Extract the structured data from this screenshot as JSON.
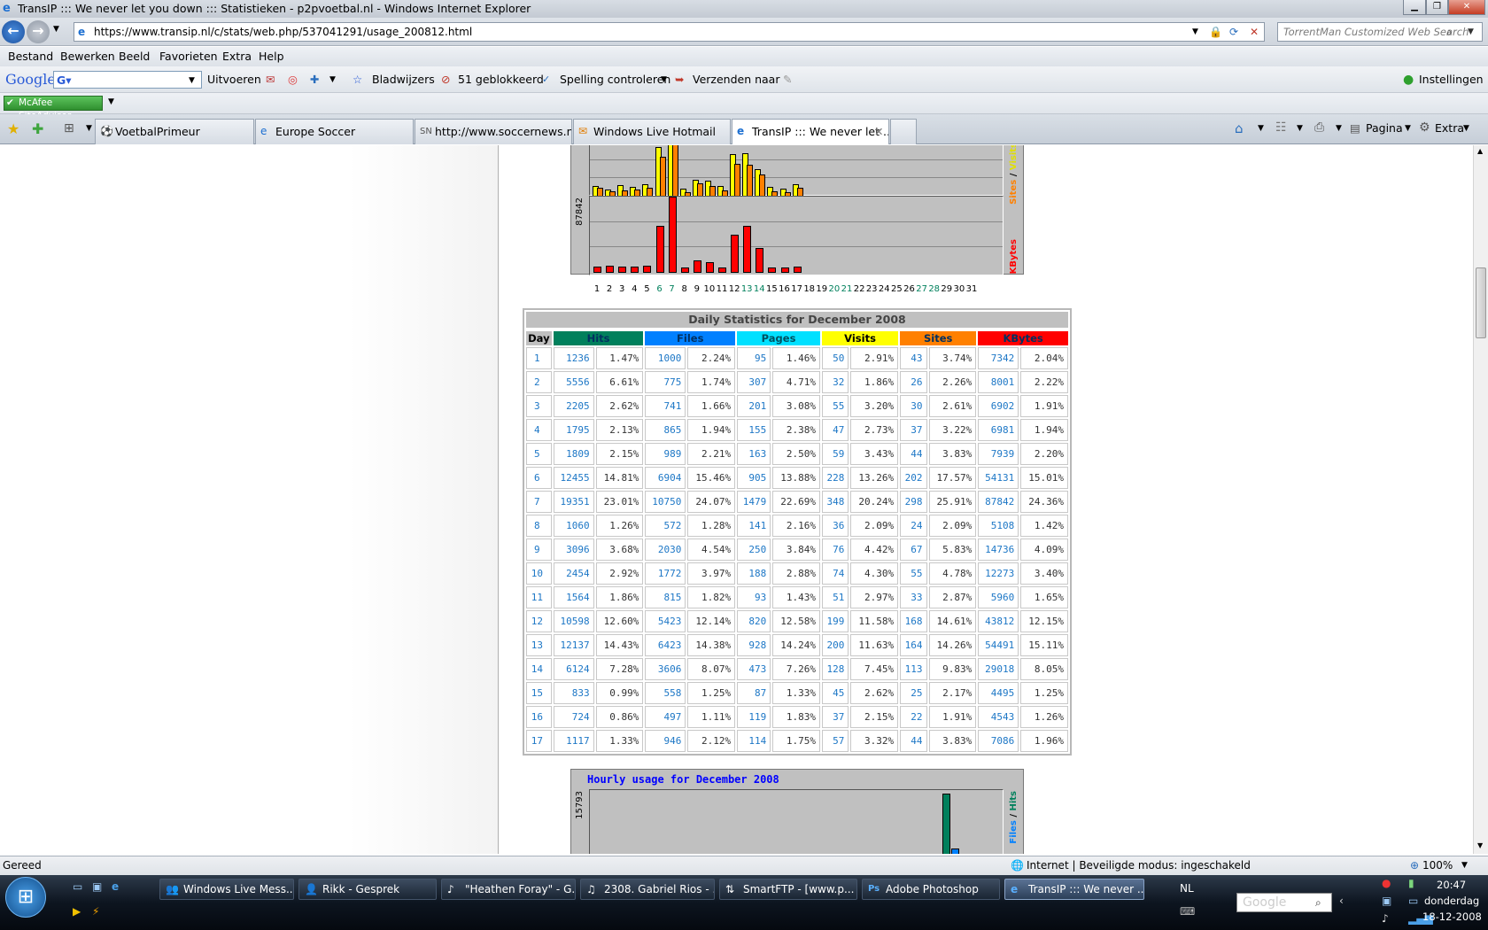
{
  "window": {
    "title": "TransIP ::: We never let you down ::: Statistieken - p2pvoetbal.nl - Windows Internet Explorer"
  },
  "address": {
    "url": "https://www.transip.nl/c/stats/web.php/537041291/usage_200812.html",
    "search_placeholder": "TorrentMan Customized Web Search"
  },
  "menu": [
    "Bestand",
    "Bewerken",
    "Beeld",
    "Favorieten",
    "Extra",
    "Help"
  ],
  "google_toolbar": {
    "logo": "Google",
    "run": "Uitvoeren",
    "bookmarks": "Bladwijzers",
    "blocked": "51 geblokkeerd",
    "spell": "Spelling controleren",
    "send": "Verzenden naar",
    "settings": "Instellingen"
  },
  "mcafee": {
    "label": "McAfee SiteAdvisor"
  },
  "tabs": [
    "VoetbalPrimeur",
    "Europe Soccer",
    "http://www.soccernews.nl...",
    "Windows Live Hotmail",
    "TransIP ::: We never let ..."
  ],
  "tab_favicons": [
    "⚽",
    "e",
    "SN",
    "✉",
    "e"
  ],
  "command_bar": {
    "page": "Pagina",
    "extra": "Extra"
  },
  "daily_chart": {
    "kbytes_max_label": "87842",
    "right_label_sites": "Sites",
    "right_label_visits": "Visits",
    "right_label_kbytes": "KBytes",
    "sep": " / ",
    "days": [
      "1",
      "2",
      "3",
      "4",
      "5",
      "6",
      "7",
      "8",
      "9",
      "10",
      "11",
      "12",
      "13",
      "14",
      "15",
      "16",
      "17",
      "18",
      "19",
      "20",
      "21",
      "22",
      "23",
      "24",
      "25",
      "26",
      "27",
      "28",
      "29",
      "30",
      "31"
    ],
    "visits": [
      50,
      32,
      55,
      47,
      59,
      228,
      348,
      36,
      76,
      74,
      51,
      199,
      200,
      128,
      45,
      37,
      57
    ],
    "sites": [
      43,
      26,
      30,
      37,
      44,
      202,
      298,
      24,
      67,
      55,
      33,
      168,
      164,
      113,
      25,
      22,
      44
    ],
    "kbytes": [
      7342,
      8001,
      6902,
      6981,
      7939,
      54131,
      87842,
      5108,
      14736,
      12273,
      5960,
      43812,
      54491,
      29018,
      4495,
      4543,
      7086
    ],
    "weekend_days": [
      6,
      7,
      13,
      14,
      20,
      21,
      27,
      28
    ]
  },
  "table": {
    "title": "Daily Statistics for December 2008",
    "headers": [
      "Day",
      "Hits",
      "Files",
      "Pages",
      "Visits",
      "Sites",
      "KBytes"
    ],
    "header_colors": [
      "#c0c0c0",
      "#00805c",
      "#0080ff",
      "#00e0ff",
      "#ffff00",
      "#ff8000",
      "#ff0000"
    ],
    "rows": [
      [
        "1",
        "1236",
        "1.47%",
        "1000",
        "2.24%",
        "95",
        "1.46%",
        "50",
        "2.91%",
        "43",
        "3.74%",
        "7342",
        "2.04%"
      ],
      [
        "2",
        "5556",
        "6.61%",
        "775",
        "1.74%",
        "307",
        "4.71%",
        "32",
        "1.86%",
        "26",
        "2.26%",
        "8001",
        "2.22%"
      ],
      [
        "3",
        "2205",
        "2.62%",
        "741",
        "1.66%",
        "201",
        "3.08%",
        "55",
        "3.20%",
        "30",
        "2.61%",
        "6902",
        "1.91%"
      ],
      [
        "4",
        "1795",
        "2.13%",
        "865",
        "1.94%",
        "155",
        "2.38%",
        "47",
        "2.73%",
        "37",
        "3.22%",
        "6981",
        "1.94%"
      ],
      [
        "5",
        "1809",
        "2.15%",
        "989",
        "2.21%",
        "163",
        "2.50%",
        "59",
        "3.43%",
        "44",
        "3.83%",
        "7939",
        "2.20%"
      ],
      [
        "6",
        "12455",
        "14.81%",
        "6904",
        "15.46%",
        "905",
        "13.88%",
        "228",
        "13.26%",
        "202",
        "17.57%",
        "54131",
        "15.01%"
      ],
      [
        "7",
        "19351",
        "23.01%",
        "10750",
        "24.07%",
        "1479",
        "22.69%",
        "348",
        "20.24%",
        "298",
        "25.91%",
        "87842",
        "24.36%"
      ],
      [
        "8",
        "1060",
        "1.26%",
        "572",
        "1.28%",
        "141",
        "2.16%",
        "36",
        "2.09%",
        "24",
        "2.09%",
        "5108",
        "1.42%"
      ],
      [
        "9",
        "3096",
        "3.68%",
        "2030",
        "4.54%",
        "250",
        "3.84%",
        "76",
        "4.42%",
        "67",
        "5.83%",
        "14736",
        "4.09%"
      ],
      [
        "10",
        "2454",
        "2.92%",
        "1772",
        "3.97%",
        "188",
        "2.88%",
        "74",
        "4.30%",
        "55",
        "4.78%",
        "12273",
        "3.40%"
      ],
      [
        "11",
        "1564",
        "1.86%",
        "815",
        "1.82%",
        "93",
        "1.43%",
        "51",
        "2.97%",
        "33",
        "2.87%",
        "5960",
        "1.65%"
      ],
      [
        "12",
        "10598",
        "12.60%",
        "5423",
        "12.14%",
        "820",
        "12.58%",
        "199",
        "11.58%",
        "168",
        "14.61%",
        "43812",
        "12.15%"
      ],
      [
        "13",
        "12137",
        "14.43%",
        "6423",
        "14.38%",
        "928",
        "14.24%",
        "200",
        "11.63%",
        "164",
        "14.26%",
        "54491",
        "15.11%"
      ],
      [
        "14",
        "6124",
        "7.28%",
        "3606",
        "8.07%",
        "473",
        "7.26%",
        "128",
        "7.45%",
        "113",
        "9.83%",
        "29018",
        "8.05%"
      ],
      [
        "15",
        "833",
        "0.99%",
        "558",
        "1.25%",
        "87",
        "1.33%",
        "45",
        "2.62%",
        "25",
        "2.17%",
        "4495",
        "1.25%"
      ],
      [
        "16",
        "724",
        "0.86%",
        "497",
        "1.11%",
        "119",
        "1.83%",
        "37",
        "2.15%",
        "22",
        "1.91%",
        "4543",
        "1.26%"
      ],
      [
        "17",
        "1117",
        "1.33%",
        "946",
        "2.12%",
        "114",
        "1.75%",
        "57",
        "3.32%",
        "44",
        "3.83%",
        "7086",
        "1.96%"
      ]
    ]
  },
  "hourly_chart": {
    "title": "Hourly usage for December 2008",
    "max_label": "15793",
    "right_label_files": "Files",
    "right_label_hits": "Hits",
    "sep": " / "
  },
  "status": {
    "left": "Gereed",
    "zone": "Internet | Beveiligde modus: ingeschakeld",
    "zoom": "100%"
  },
  "taskbar": {
    "buttons": [
      "Windows Live Mess...",
      "Rikk - Gesprek",
      "\"Heathen Foray\" - G...",
      "2308. Gabriel Rios - ...",
      "SmartFTP - [www.p...",
      "Adobe Photoshop",
      "TransIP ::: We never ..."
    ],
    "icons": [
      "👥",
      "👤",
      "♪",
      "♫",
      "⇅",
      "Ps",
      "e"
    ],
    "lang": "NL",
    "time": "20:47",
    "day": "donderdag",
    "date": "18-12-2008",
    "search_placeholder": "Google"
  }
}
